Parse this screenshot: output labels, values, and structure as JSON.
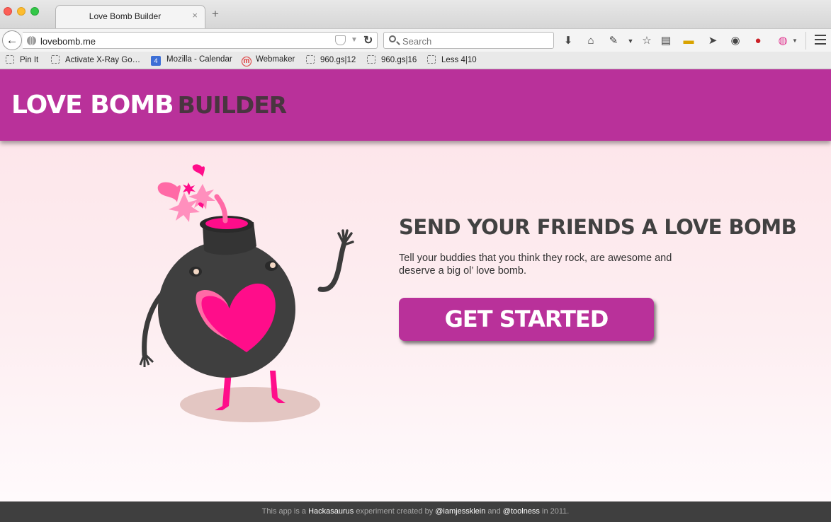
{
  "browser": {
    "tab_title": "Love Bomb Builder",
    "tab_close": "×",
    "new_tab": "+",
    "url": "lovebomb.me",
    "search_placeholder": "Search",
    "back": "←",
    "toolbar_icons": [
      "download-icon",
      "home-icon",
      "eyedropper-icon",
      "bookmark-star-icon",
      "reading-list-icon",
      "ruler-icon",
      "send-icon",
      "history-icon",
      "pinterest-icon",
      "color-wheel-icon",
      "menu-icon"
    ],
    "bookmarks": [
      {
        "label": "Pin It"
      },
      {
        "label": "Activate X-Ray Go…"
      },
      {
        "label": "Mozilla - Calendar",
        "badge": "4"
      },
      {
        "label": "Webmaker",
        "badge": "m"
      },
      {
        "label": "960.gs|12"
      },
      {
        "label": "960.gs|16"
      },
      {
        "label": "Less 4|10"
      }
    ]
  },
  "header": {
    "logo_love": "LOVE BOMB",
    "logo_builder": "BUILDER",
    "colors": {
      "header_bg": "#b9319a",
      "accent_pink": "#ff0d8a"
    }
  },
  "hero": {
    "title": "SEND YOUR FRIENDS A LOVE BOMB",
    "text": "Tell your buddies that you think they rock, are awesome and deserve a big ol’ love bomb.",
    "cta_label": "GET STARTED"
  },
  "footer": {
    "t1": "This app is a ",
    "link1": "Hackasaurus",
    "t2": " experiment created by ",
    "link2": "@iamjessklein",
    "t3": " and ",
    "link3": "@toolness",
    "t4": " in 2011."
  }
}
